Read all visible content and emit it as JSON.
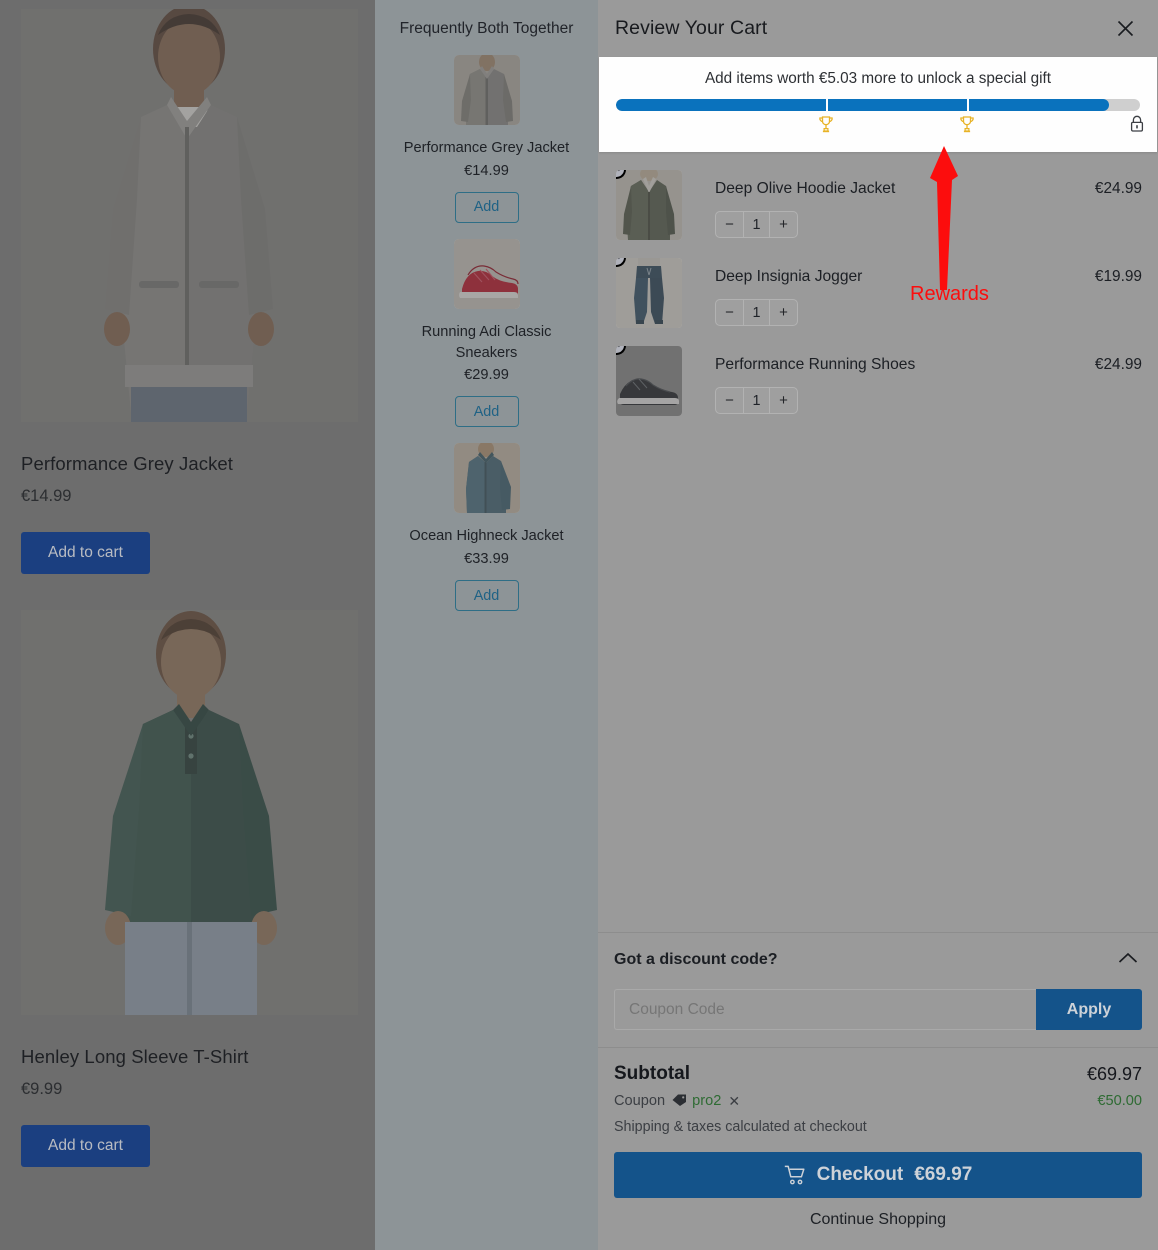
{
  "products": [
    {
      "name": "Performance Grey Jacket",
      "price": "€14.99",
      "add_label": "Add to cart",
      "image_alt": "man-in-grey-zip-jacket"
    },
    {
      "name": "Henley Long Sleeve T-Shirt",
      "price": "€9.99",
      "add_label": "Add to cart",
      "image_alt": "man-in-dark-green-henley-shirt"
    }
  ],
  "recommendations": {
    "heading": "Frequently Both Together",
    "items": [
      {
        "name": "Performance Grey Jacket",
        "price": "€14.99",
        "add_label": "Add",
        "image_alt": "grey-zip-jacket"
      },
      {
        "name": "Running Adi Classic Sneakers",
        "price": "€29.99",
        "add_label": "Add",
        "image_alt": "red-sneakers"
      },
      {
        "name": "Ocean Highneck Jacket",
        "price": "€33.99",
        "add_label": "Add",
        "image_alt": "blue-highneck-jacket"
      }
    ]
  },
  "cart": {
    "title": "Review Your Cart",
    "close_label": "✕",
    "rewards": {
      "message": "Add items worth €5.03 more to unlock a special gift",
      "progress_percent": 94,
      "milestone_positions": [
        40,
        67
      ],
      "milestone_icon": "trophy-icon",
      "locked_icon": "lock-icon"
    },
    "items": [
      {
        "name": "Deep Olive Hoodie Jacket",
        "price": "€24.99",
        "quantity": "1",
        "decrement_label": "−",
        "increment_label": "+",
        "remove_label": "✕",
        "image_alt": "olive-hoodie-jacket"
      },
      {
        "name": "Deep Insignia Jogger",
        "price": "€19.99",
        "quantity": "1",
        "decrement_label": "−",
        "increment_label": "+",
        "remove_label": "✕",
        "image_alt": "navy-jogger-pants"
      },
      {
        "name": "Performance Running Shoes",
        "price": "€24.99",
        "quantity": "1",
        "decrement_label": "−",
        "increment_label": "+",
        "remove_label": "✕",
        "image_alt": "black-running-shoes"
      }
    ],
    "discount": {
      "heading": "Got a discount code?",
      "input_value": "",
      "input_placeholder": "Coupon Code",
      "apply_label": "Apply"
    },
    "totals": {
      "subtotal_label": "Subtotal",
      "subtotal_value": "€69.97",
      "coupon_label": "Coupon",
      "coupon_code": "pro2",
      "coupon_remove_label": "✕",
      "coupon_amount": "€50.00",
      "shipping_note": "Shipping & taxes calculated at checkout",
      "checkout_label": "Checkout",
      "checkout_total": "€69.97",
      "continue_label": "Continue Shopping"
    }
  },
  "annotation": {
    "label": "Rewards",
    "color": "#fc0d0d"
  }
}
